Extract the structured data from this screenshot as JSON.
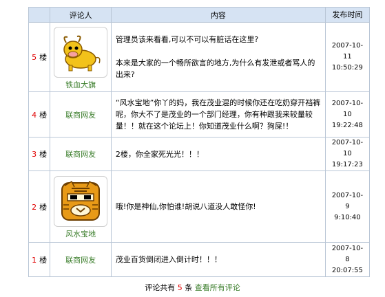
{
  "table": {
    "headers": {
      "user": "评论人",
      "content": "内容",
      "time": "发布时间"
    },
    "floor_suffix": "楼",
    "rows": [
      {
        "floor": "5",
        "user": "铁血大旗",
        "avatar": "cow-avatar-icon",
        "content": "管理员该来看看,可以不可以有脏话在这里?\n\n本来是大家的一个畅所欲言的地方,为什么有发泄或者骂人的出来?",
        "time": [
          "2007-10-",
          "11",
          "10:50:29"
        ]
      },
      {
        "floor": "4",
        "user": "联商网友",
        "avatar": "",
        "content": "“风水宝地”你丫的妈，我在茂业混的时候你还在吃奶穿开裆裤呢，你大不了是茂业的一个部门经理，你有种跟我来较量较量！！就在这个论坛上！你知道茂业什么啊？狗屎!！",
        "time": [
          "2007-10-",
          "10",
          "19:22:48"
        ]
      },
      {
        "floor": "3",
        "user": "联商网友",
        "avatar": "",
        "content": "2楼，你全家死光光！！！",
        "time": [
          "2007-10-",
          "10",
          "19:17:23"
        ]
      },
      {
        "floor": "2",
        "user": "风水宝地",
        "avatar": "tiger-avatar-icon",
        "content": "哦!你是神仙,你怕谁!胡说八道没人敢怪你!",
        "time": [
          "2007-10-",
          "9",
          "9:10:40"
        ]
      },
      {
        "floor": "1",
        "user": "联商网友",
        "avatar": "",
        "content": "茂业百货倒闭进入倒计时！！！",
        "time": [
          "2007-10-",
          "8",
          "20:07:55"
        ]
      }
    ]
  },
  "footer": {
    "prefix": "评论共有",
    "count": "5",
    "unit": "条",
    "link": "查看所有评论"
  },
  "colors": {
    "header_bg": "#d6e3f3",
    "border": "#b9c6d6",
    "floor": "#e00000",
    "username": "#3a7d2a"
  }
}
